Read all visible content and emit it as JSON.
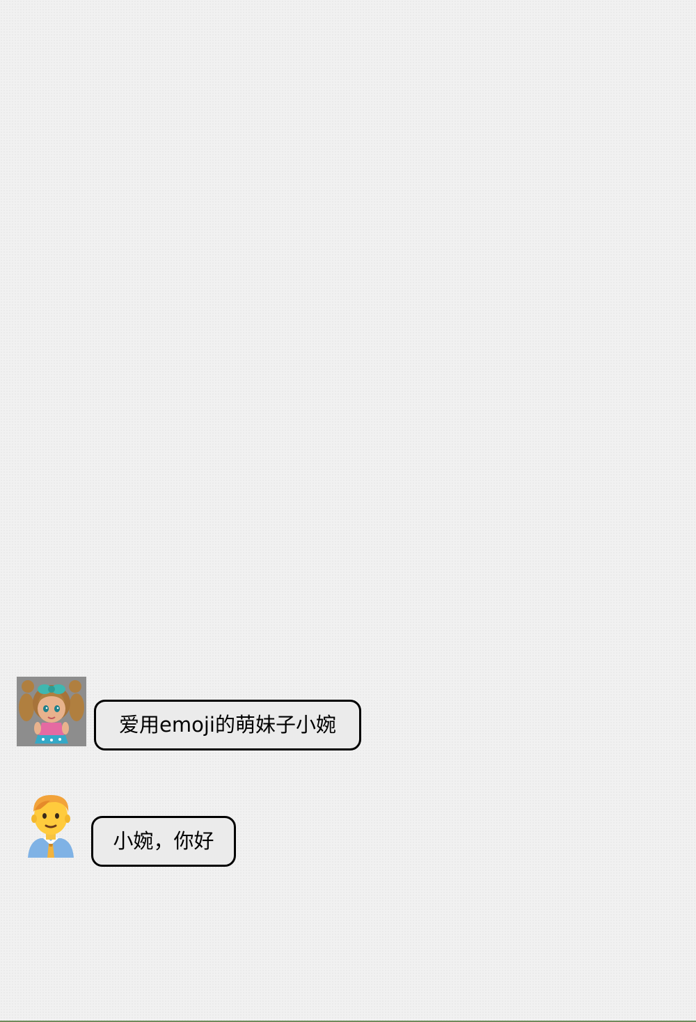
{
  "messages": [
    {
      "sender": "girl",
      "avatar_icon": "girl-avatar-icon",
      "text": "爱用emoji的萌妹子小婉"
    },
    {
      "sender": "man",
      "avatar_icon": "man-avatar-icon",
      "text": "小婉，你好"
    }
  ],
  "colors": {
    "background": "#f1f1f1",
    "bubble_fill": "#ebebeb",
    "bubble_border": "#000000",
    "girl_avatar_bg": "#8d8d8d",
    "bottom_rule": "#6f8a5b"
  }
}
